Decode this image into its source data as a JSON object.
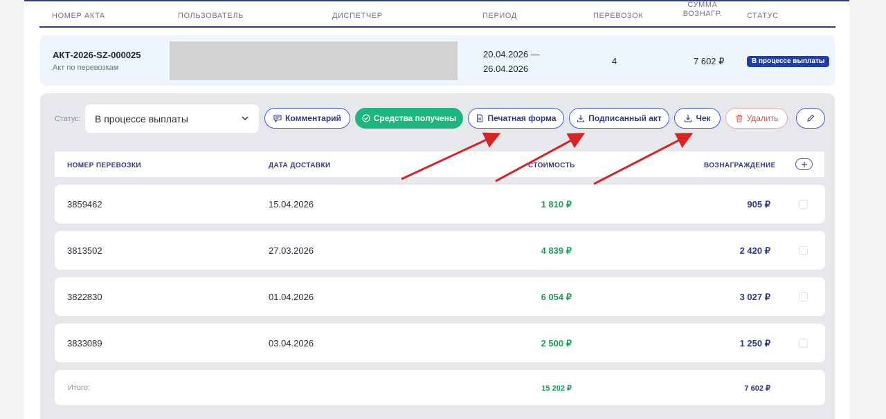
{
  "columns": {
    "act_number": "НОМЕР АКТА",
    "user": "ПОЛЬЗОВАТЕЛЬ",
    "dispatcher": "ДИСПЕТЧЕР",
    "period": "ПЕРИОД",
    "trips": "ПЕРЕВОЗОК",
    "reward_sum": "СУММА ВОЗНАГР.",
    "status": "СТАТУС"
  },
  "act": {
    "number": "АКТ-2026-SZ-000025",
    "subtitle": "Акт по перевозкам",
    "period_start": "20.04.2026 —",
    "period_end": "26.04.2026",
    "trips": "4",
    "reward_sum": "7 602 ₽",
    "status_badge": "В процессе выплаты"
  },
  "panel": {
    "status_label": "Статус:",
    "status_value": "В процессе выплаты",
    "buttons": {
      "comment": "Комментарий",
      "funds_received": "Средства получены",
      "print_form": "Печатная форма",
      "signed_act": "Подписанный акт",
      "receipt": "Чек",
      "delete": "Удалить"
    }
  },
  "shipments": {
    "headers": {
      "number": "НОМЕР ПЕРЕВОЗКИ",
      "delivery_date": "ДАТА ДОСТАВКИ",
      "cost": "СТОИМОСТЬ",
      "reward": "ВОЗНАГРАЖДЕНИЕ"
    },
    "rows": [
      {
        "number": "3859462",
        "date": "15.04.2026",
        "cost": "1 810 ₽",
        "reward": "905 ₽"
      },
      {
        "number": "3813502",
        "date": "27.03.2026",
        "cost": "4 839 ₽",
        "reward": "2 420 ₽"
      },
      {
        "number": "3822830",
        "date": "01.04.2026",
        "cost": "6 054 ₽",
        "reward": "3 027 ₽"
      },
      {
        "number": "3833089",
        "date": "03.04.2026",
        "cost": "2 500 ₽",
        "reward": "1 250 ₽"
      }
    ],
    "total": {
      "label": "Итого:",
      "cost": "15 202 ₽",
      "reward": "7 602 ₽"
    }
  },
  "colors": {
    "accent": "#2b3a8c",
    "success": "#1fb57f",
    "danger": "#e0534e",
    "annotation_arrow": "#d62424"
  }
}
